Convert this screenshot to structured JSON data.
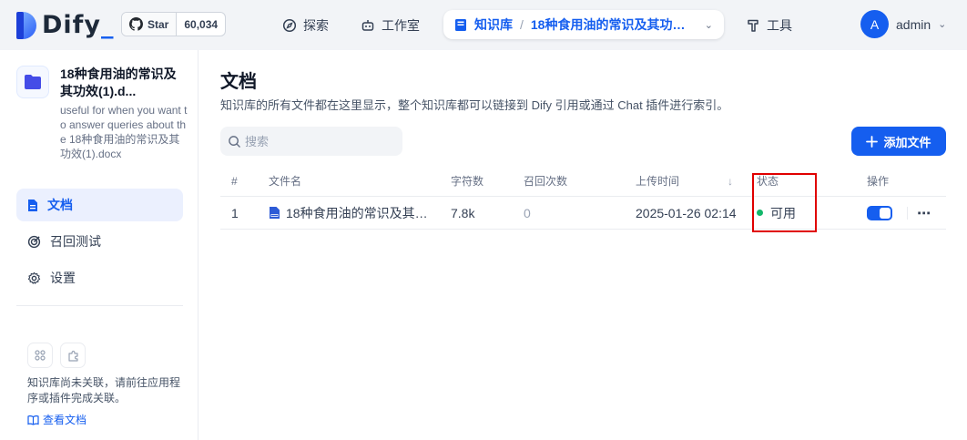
{
  "header": {
    "logo_text": "Dify",
    "logo_underscore": "_",
    "star_label": "Star",
    "star_count": "60,034",
    "nav": {
      "explore": "探索",
      "studio": "工作室",
      "knowledge": "知识库",
      "dataset_name": "18种食用油的常识及其功效(1).docx",
      "tools": "工具"
    },
    "user": {
      "initial": "A",
      "name": "admin"
    }
  },
  "sidebar": {
    "dataset_title": "18种食用油的常识及其功效(1).d...",
    "dataset_desc": "useful for when you want to answer queries about the 18种食用油的常识及其功效(1).docx",
    "items": [
      {
        "label": "文档"
      },
      {
        "label": "召回测试"
      },
      {
        "label": "设置"
      }
    ],
    "unlinked_text": "知识库尚未关联，请前往应用程序或插件完成关联。",
    "view_docs": "查看文档"
  },
  "main": {
    "title": "文档",
    "subtitle": "知识库的所有文件都在这里显示，整个知识库都可以链接到 Dify 引用或通过 Chat 插件进行索引。",
    "search_placeholder": "搜索",
    "add_button": "添加文件",
    "columns": {
      "index": "#",
      "name": "文件名",
      "chars": "字符数",
      "hits": "召回次数",
      "upload_time": "上传时间",
      "status": "状态",
      "ops": "操作"
    },
    "rows": [
      {
        "index": "1",
        "name": "18种食用油的常识及其功效(1).docx",
        "chars": "7.8k",
        "hits": "0",
        "upload_time": "2025-01-26 02:14",
        "status": "可用",
        "enabled": true
      }
    ]
  },
  "colors": {
    "accent": "#155eef",
    "status_ok": "#12b76a",
    "highlight": "#e00000"
  }
}
